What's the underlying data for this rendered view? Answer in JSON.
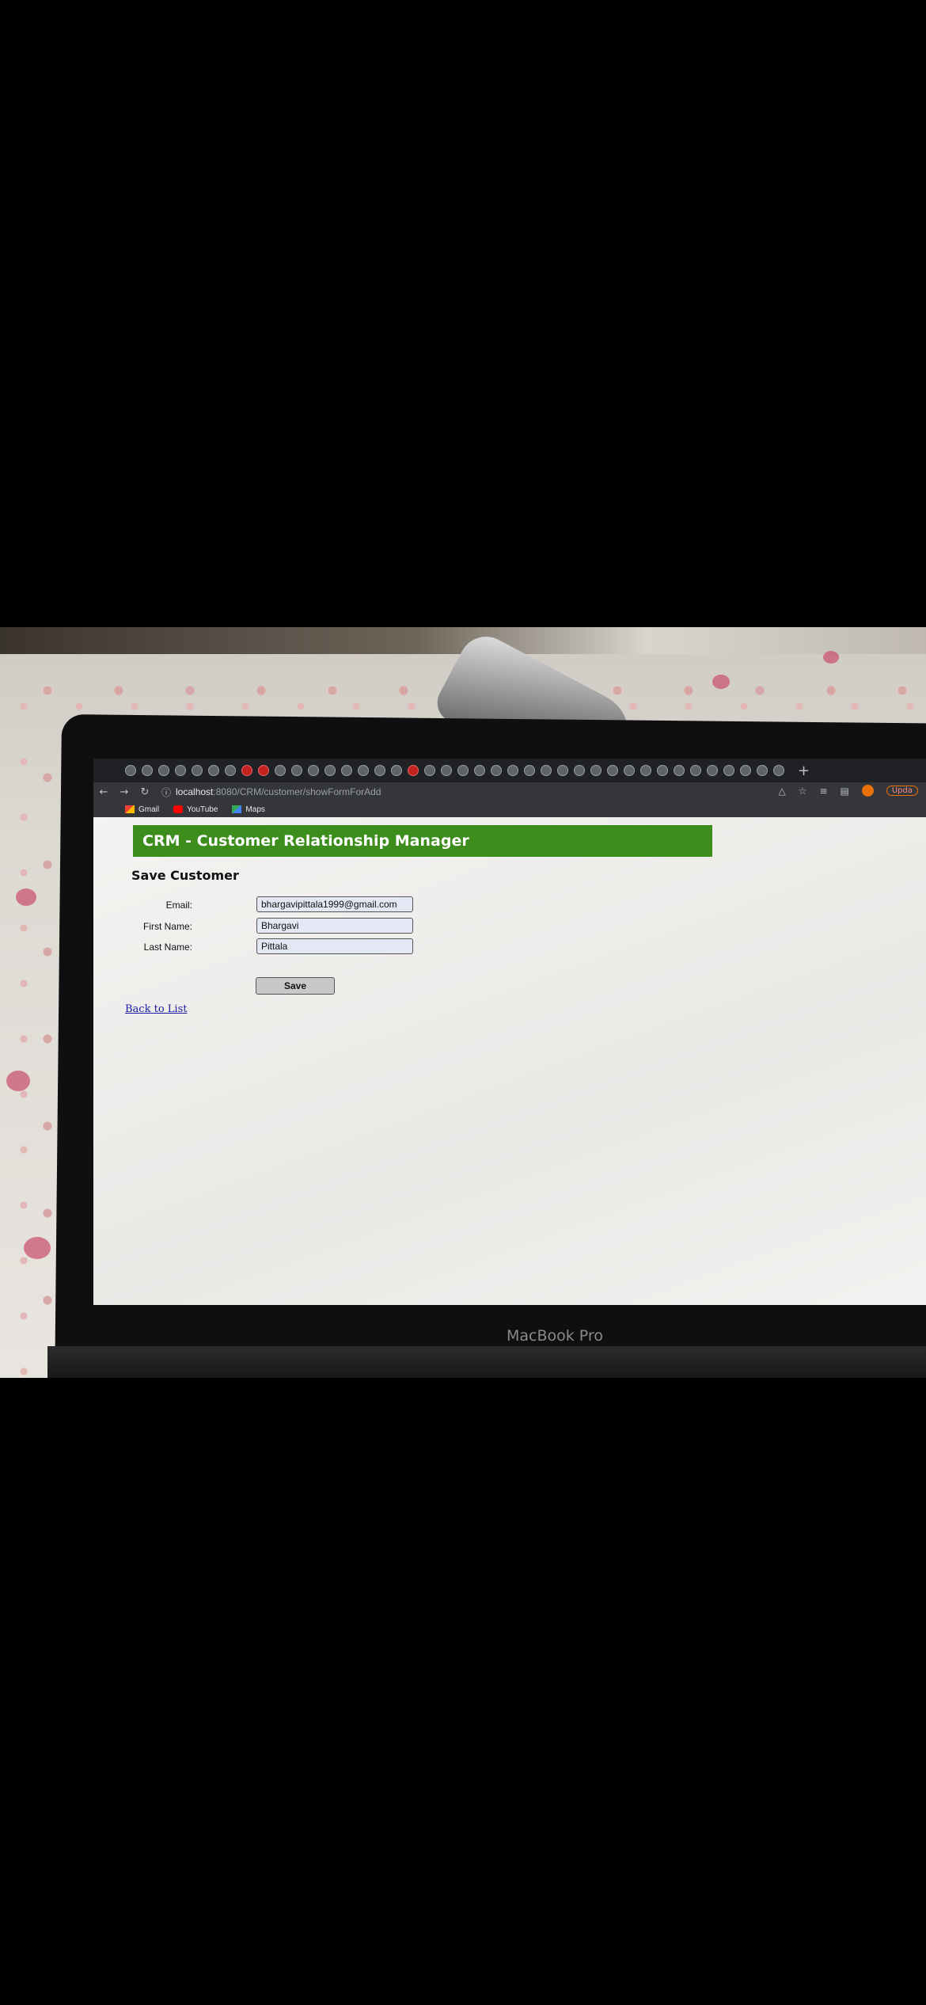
{
  "browser": {
    "url_host": "localhost",
    "url_path": ":8080/CRM/customer/showFormForAdd",
    "new_tab": "+",
    "update_label": "Upda",
    "bookmarks": [
      {
        "label": "Gmail",
        "icon": "gmail-icon"
      },
      {
        "label": "YouTube",
        "icon": "youtube-icon"
      },
      {
        "label": "Maps",
        "icon": "maps-icon"
      }
    ]
  },
  "page": {
    "header": "CRM - Customer Relationship Manager",
    "title": "Save Customer",
    "form": {
      "email_label": "Email:",
      "email_value": "bhargavipittala1999@gmail.com",
      "first_name_label": "First Name:",
      "first_name_value": "Bhargavi",
      "last_name_label": "Last Name:",
      "last_name_value": "Pittala",
      "save_label": "Save"
    },
    "back_link": "Back to List"
  },
  "device": {
    "label": "MacBook Pro"
  },
  "colors": {
    "header_green": "#3c8d1c",
    "link_blue": "#1a1aa6"
  }
}
